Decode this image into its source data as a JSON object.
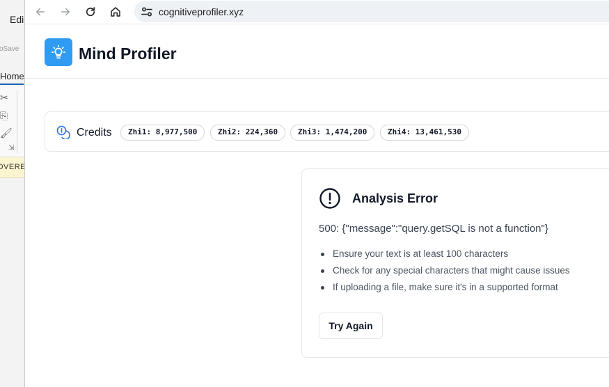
{
  "background_app": {
    "menu_edit": "Edi",
    "autosave": "oSave",
    "tab_home": "Home",
    "banner_text": "OVERED"
  },
  "browser": {
    "url": "cognitiveprofiler.xyz"
  },
  "app": {
    "title": "Mind Profiler",
    "brand_color": "#2f9bf3"
  },
  "credits": {
    "label": "Credits",
    "items": [
      {
        "label": "Zhi1: 8,977,500"
      },
      {
        "label": "Zhi2: 224,360"
      },
      {
        "label": "Zhi3: 1,474,200"
      },
      {
        "label": "Zhi4: 13,461,530"
      }
    ]
  },
  "error": {
    "title": "Analysis Error",
    "message": "500: {\"message\":\"query.getSQL is not a function\"}",
    "tips": [
      "Ensure your text is at least 100 characters",
      "Check for any special characters that might cause issues",
      "If uploading a file, make sure it's in a supported format"
    ],
    "retry_label": "Try Again"
  }
}
